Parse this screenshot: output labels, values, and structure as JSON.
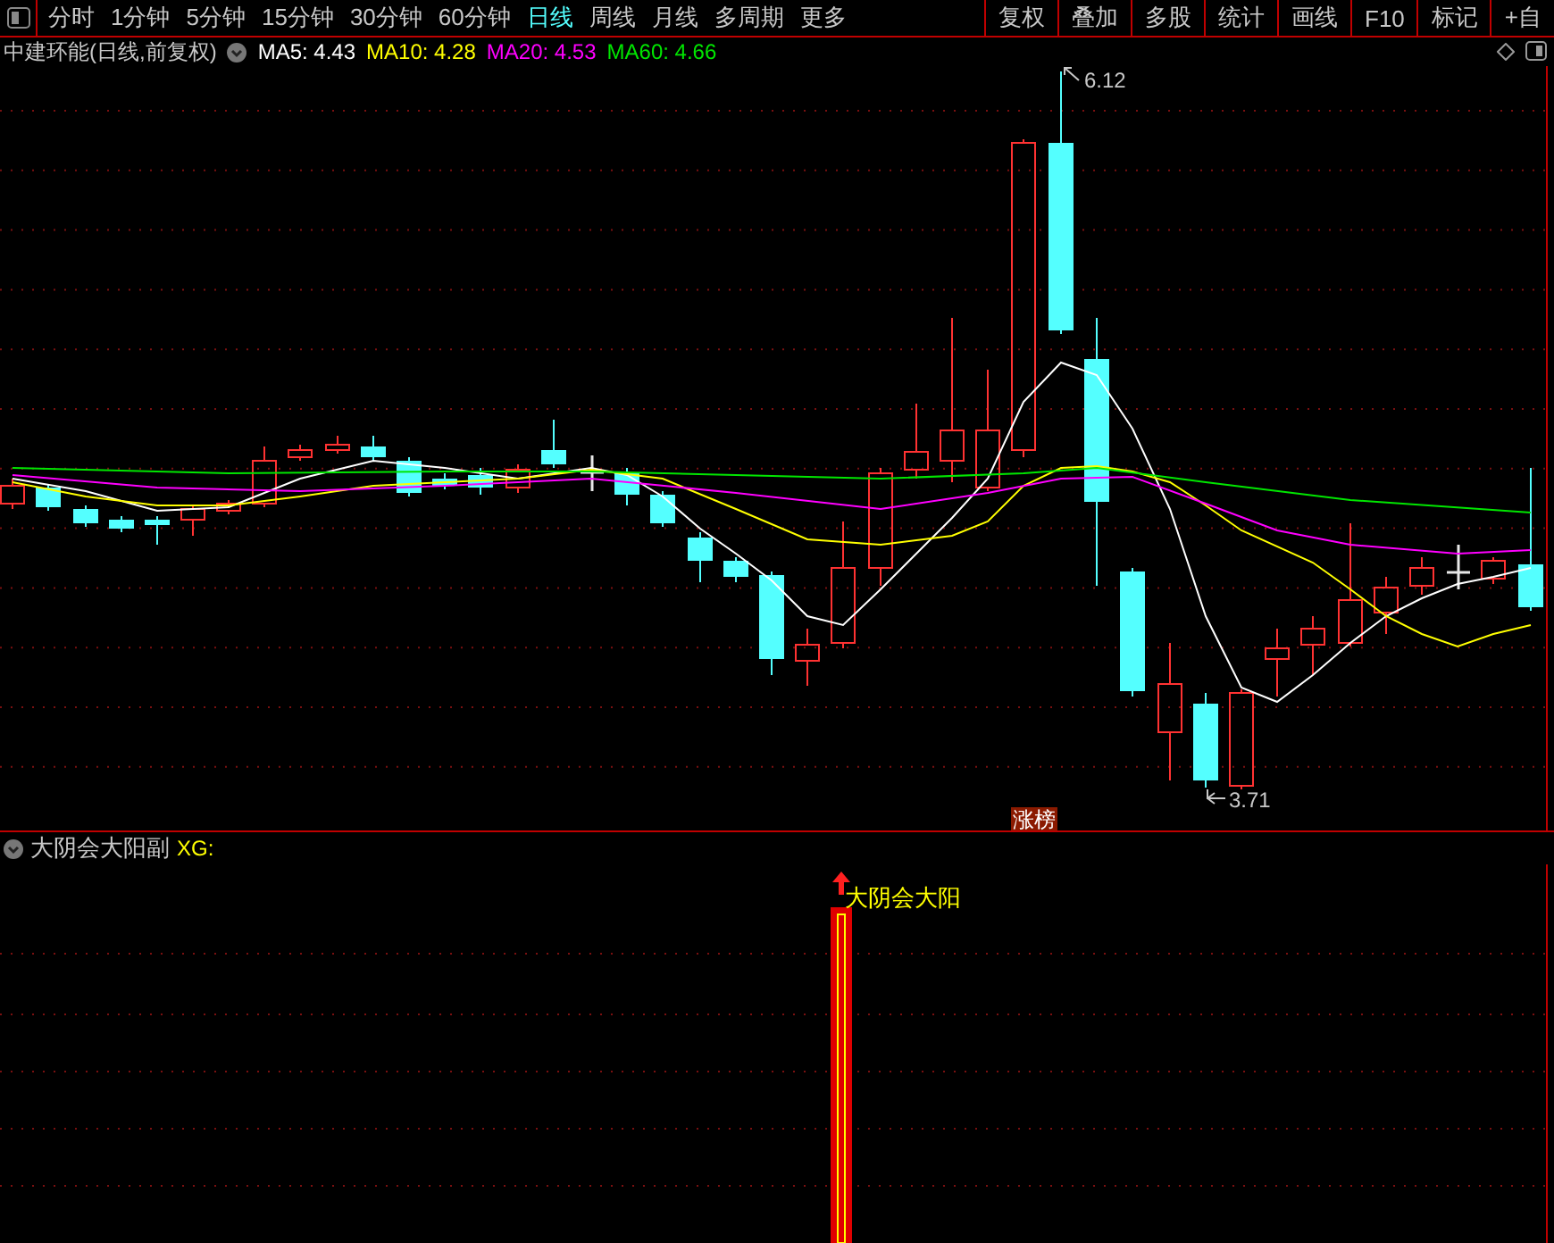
{
  "toolbar": {
    "periods": [
      {
        "label": "分时",
        "selected": false
      },
      {
        "label": "1分钟",
        "selected": false
      },
      {
        "label": "5分钟",
        "selected": false
      },
      {
        "label": "15分钟",
        "selected": false
      },
      {
        "label": "30分钟",
        "selected": false
      },
      {
        "label": "60分钟",
        "selected": false
      },
      {
        "label": "日线",
        "selected": true
      },
      {
        "label": "周线",
        "selected": false
      },
      {
        "label": "月线",
        "selected": false
      },
      {
        "label": "多周期",
        "selected": false
      },
      {
        "label": "更多",
        "selected": false
      }
    ],
    "tools": [
      "复权",
      "叠加",
      "多股",
      "统计",
      "画线",
      "F10",
      "标记",
      "+自"
    ]
  },
  "main_chart": {
    "title": "中建环能(日线,前复权)",
    "indicators": [
      {
        "label": "MA5: 4.43",
        "color": "#ffffff"
      },
      {
        "label": "MA10: 4.28",
        "color": "#ffff00"
      },
      {
        "label": "MA20: 4.53",
        "color": "#ff00ff"
      },
      {
        "label": "MA60: 4.66",
        "color": "#00e600"
      }
    ],
    "high_label": "6.12",
    "low_label": "3.71",
    "badge": "涨榜"
  },
  "sub_chart": {
    "title": "大阴会大阳副",
    "output": "XG:",
    "signal_label": "大阴会大阳"
  }
}
